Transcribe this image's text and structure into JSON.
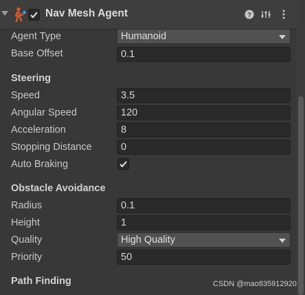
{
  "component": {
    "title": "Nav Mesh Agent",
    "enabled": true,
    "icons": [
      "fold-arrow-icon",
      "nav-mesh-agent-icon",
      "help-icon",
      "presets-icon",
      "kebab-menu-icon"
    ]
  },
  "fields": {
    "agent_type": {
      "label": "Agent Type",
      "value": "Humanoid"
    },
    "base_offset": {
      "label": "Base Offset",
      "value": "0.1"
    }
  },
  "steering": {
    "title": "Steering",
    "speed": {
      "label": "Speed",
      "value": "3.5"
    },
    "angular_speed": {
      "label": "Angular Speed",
      "value": "120"
    },
    "acceleration": {
      "label": "Acceleration",
      "value": "8"
    },
    "stopping_distance": {
      "label": "Stopping Distance",
      "value": "0"
    },
    "auto_braking": {
      "label": "Auto Braking",
      "checked": true
    }
  },
  "obstacle_avoidance": {
    "title": "Obstacle Avoidance",
    "radius": {
      "label": "Radius",
      "value": "0.1"
    },
    "height": {
      "label": "Height",
      "value": "1"
    },
    "quality": {
      "label": "Quality",
      "value": "High Quality"
    },
    "priority": {
      "label": "Priority",
      "value": "50"
    }
  },
  "path_finding": {
    "title": "Path Finding"
  },
  "watermark": "CSDN @mao835912920",
  "colors": {
    "background": "#383838",
    "field": "#2a2a2a",
    "dropdown": "#515151",
    "agent_icon": "#e05a2a"
  }
}
